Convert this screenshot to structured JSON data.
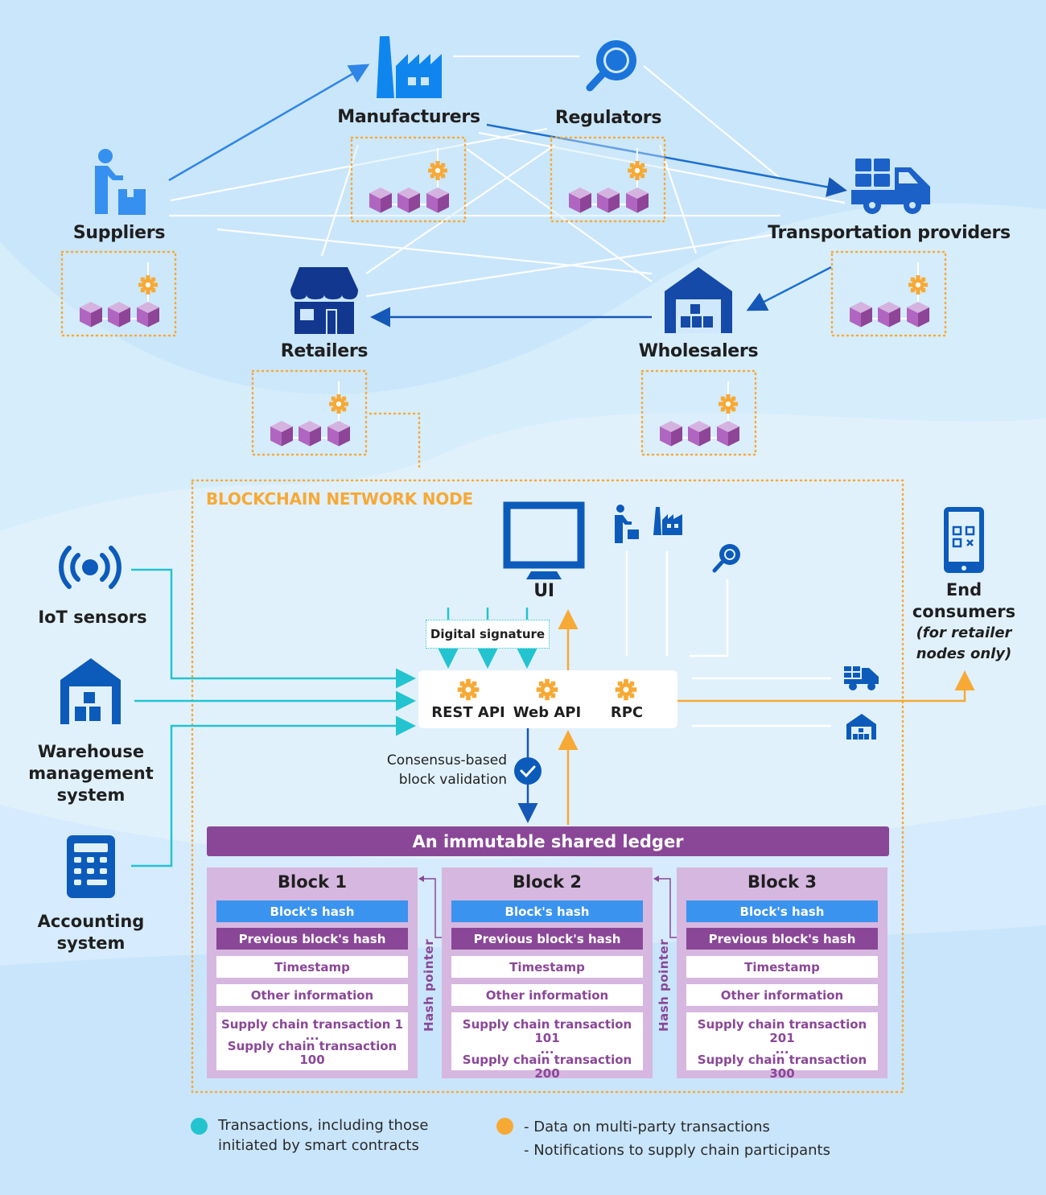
{
  "colors": {
    "background": "#cae6fb",
    "transaction_flow": "#23c4cf",
    "data_flow": "#f7a935",
    "ledger_purple": "#8a4797",
    "block_bg": "#d6b7e0",
    "hash_blue": "#3a93ee",
    "icon_blue": "#1565c0",
    "icon_navy": "#12378f"
  },
  "network": {
    "participants": [
      {
        "id": "manufacturers",
        "label": "Manufacturers",
        "icon": "factory-icon"
      },
      {
        "id": "regulators",
        "label": "Regulators",
        "icon": "magnifier-icon"
      },
      {
        "id": "suppliers",
        "label": "Suppliers",
        "icon": "person-with-box-icon"
      },
      {
        "id": "transportation",
        "label": "Transportation providers",
        "icon": "truck-icon"
      },
      {
        "id": "retailers",
        "label": "Retailers",
        "icon": "storefront-icon"
      },
      {
        "id": "wholesalers",
        "label": "Wholesalers",
        "icon": "warehouse-icon"
      }
    ],
    "node_icon": "blockchain-node-icon"
  },
  "node": {
    "title": "BLOCKCHAIN NETWORK NODE",
    "ui_label": "UI",
    "digital_signature": "Digital signature",
    "apis": [
      "REST API",
      "Web API",
      "RPC"
    ],
    "consensus_line1": "Consensus-based",
    "consensus_line2": "block validation"
  },
  "external": {
    "iot": "IoT sensors",
    "warehouse_line1": "Warehouse",
    "warehouse_line2": "management",
    "warehouse_line3": "system",
    "accounting_line1": "Accounting",
    "accounting_line2": "system",
    "consumers_line1": "End",
    "consumers_line2": "consumers",
    "consumers_note1": "(for retailer",
    "consumers_note2": "nodes only)"
  },
  "ledger": {
    "title": "An immutable shared ledger",
    "hash_pointer": "Hash pointer",
    "ellipsis": "...",
    "blocks": [
      {
        "title": "Block 1",
        "hash": "Block's hash",
        "prev": "Previous block's hash",
        "timestamp": "Timestamp",
        "other": "Other information",
        "tx_first": "Supply chain transaction 1",
        "tx_last": "Supply chain transaction 100"
      },
      {
        "title": "Block 2",
        "hash": "Block's hash",
        "prev": "Previous block's hash",
        "timestamp": "Timestamp",
        "other": "Other information",
        "tx_first": "Supply chain transaction 101",
        "tx_last": "Supply chain transaction 200"
      },
      {
        "title": "Block 3",
        "hash": "Block's hash",
        "prev": "Previous block's hash",
        "timestamp": "Timestamp",
        "other": "Other information",
        "tx_first": "Supply chain transaction 201",
        "tx_last": "Supply chain transaction 300"
      }
    ]
  },
  "legend": {
    "teal_line1": "Transactions, including those",
    "teal_line2": "initiated by smart contracts",
    "orange_line1": "- Data on multi-party transactions",
    "orange_line2": "- Notifications to supply chain participants"
  }
}
